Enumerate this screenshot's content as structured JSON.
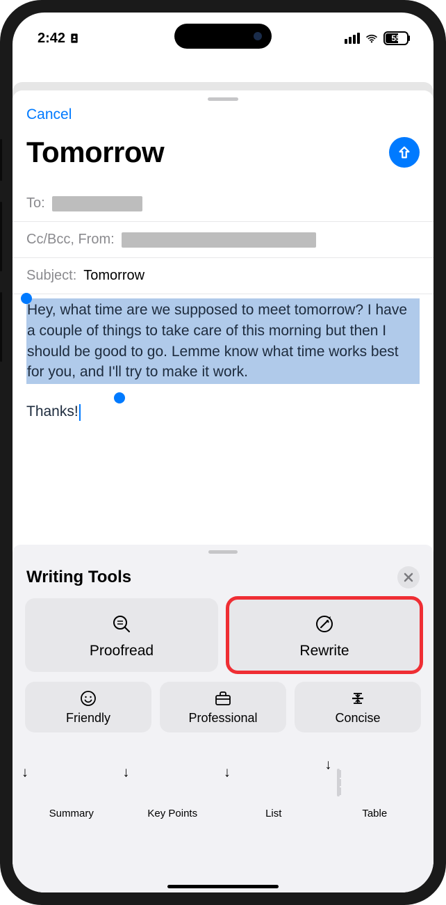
{
  "status": {
    "time": "2:42",
    "battery": "55"
  },
  "sheet": {
    "cancel": "Cancel",
    "title": "Tomorrow",
    "fields": {
      "to_label": "To:",
      "ccbcc_label": "Cc/Bcc, From:",
      "subject_label": "Subject:",
      "subject_value": "Tomorrow"
    },
    "body_selected": "Hey, what time are we supposed to meet tomorrow? I have a couple of things to take care of this morning but then I should be good to go. Lemme know what time works best for you, and I'll try to make it work.",
    "body_unselected": "Thanks!"
  },
  "tools": {
    "title": "Writing Tools",
    "proofread": "Proofread",
    "rewrite": "Rewrite",
    "friendly": "Friendly",
    "professional": "Professional",
    "concise": "Concise",
    "summary": "Summary",
    "keypoints": "Key Points",
    "list": "List",
    "table": "Table"
  }
}
